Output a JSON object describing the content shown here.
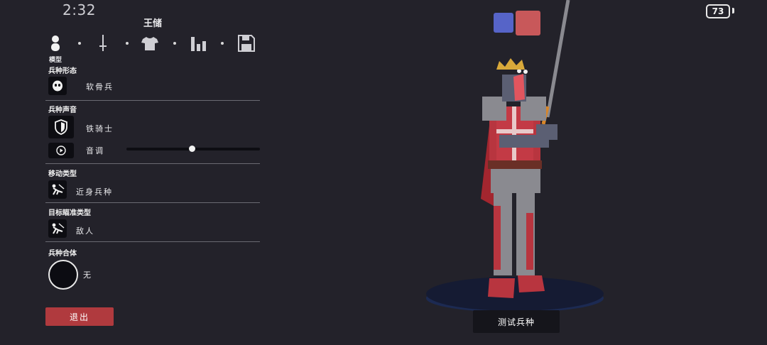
{
  "status_bar": {
    "time": "2:32",
    "battery": "73"
  },
  "header": {
    "title": "王储"
  },
  "tabs": {
    "items": [
      {
        "icon": "person-icon"
      },
      {
        "icon": "sword-icon"
      },
      {
        "icon": "shirt-icon"
      },
      {
        "icon": "stats-icon"
      },
      {
        "icon": "save-icon"
      }
    ],
    "active_label": "模型"
  },
  "sections": {
    "unit_form": {
      "label": "兵种形态",
      "value": "软骨兵"
    },
    "unit_voice": {
      "label": "兵种声音",
      "value": "铁骑士",
      "pitch_label": "音调",
      "pitch_level": 0.49
    },
    "movement": {
      "label": "移动类型",
      "value": "近身兵种"
    },
    "targeting": {
      "label": "目标瞄准类型",
      "value": "敌人"
    },
    "combine": {
      "label": "兵种合体",
      "value": "无"
    }
  },
  "buttons": {
    "exit": "退出",
    "test_unit": "测试兵种"
  },
  "colors": {
    "team_blue": "#5664c8",
    "team_red": "#c8585a",
    "accent_red": "#b03a3e"
  }
}
